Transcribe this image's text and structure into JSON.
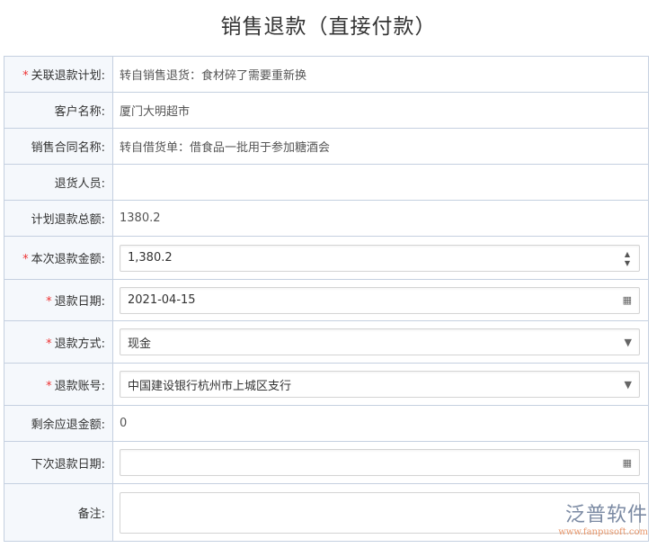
{
  "title": "销售退款（直接付款）",
  "rows": [
    {
      "label": "关联退款计划:",
      "required": true,
      "value": "转自销售退货：食材碎了需要重新换"
    },
    {
      "label": "客户名称:",
      "value": "厦门大明超市"
    },
    {
      "label": "销售合同名称:",
      "value": "转自借货单：借食品一批用于参加糖酒会"
    },
    {
      "label": "退货人员:",
      "value": ""
    },
    {
      "label": "计划退款总额:",
      "value": "1380.2"
    },
    {
      "label": "本次退款金额:",
      "required": true,
      "value": "1,380.2"
    },
    {
      "label": "退款日期:",
      "required": true,
      "value": "2021-04-15"
    },
    {
      "label": "退款方式:",
      "required": true,
      "value": "现金"
    },
    {
      "label": "退款账号:",
      "required": true,
      "value": "中国建设银行杭州市上城区支行"
    },
    {
      "label": "剩余应退金额:",
      "value": "0"
    },
    {
      "label": "下次退款日期:",
      "value": ""
    },
    {
      "label": "备注:",
      "value": ""
    }
  ],
  "required_mark": "*",
  "logo": {
    "cn": "泛普软件",
    "en": "www.fanpusoft.com"
  }
}
